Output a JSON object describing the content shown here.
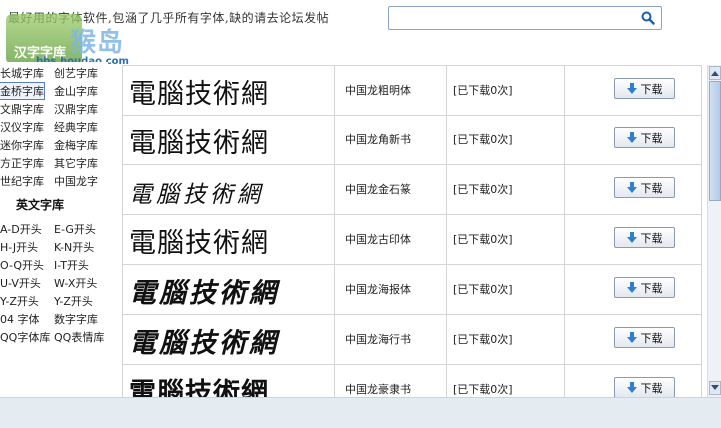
{
  "header": {
    "tagline": "最好用的字体软件,包涵了几乎所有字体,缺的请去论坛发帖",
    "search": {
      "value": "",
      "placeholder": ""
    }
  },
  "watermark": {
    "badge_text": "汉字字库",
    "big_text": "猴岛",
    "url": "bbs.houdao.com"
  },
  "sidebar": {
    "chinese_rows": [
      [
        "长城字库",
        "创艺字库"
      ],
      [
        "金桥字库",
        "金山字库"
      ],
      [
        "文鼎字库",
        "汉鼎字库"
      ],
      [
        "汉仪字库",
        "经典字库"
      ],
      [
        "迷你字库",
        "金梅字库"
      ],
      [
        "方正字库",
        "其它字库"
      ],
      [
        "世纪字库",
        "中国龙字"
      ]
    ],
    "english_title": "英文字库",
    "english_rows": [
      [
        "A-D开头",
        "E-G开头"
      ],
      [
        "H-J开头",
        "K-N开头"
      ],
      [
        "O-Q开头",
        "I-T开头"
      ],
      [
        "U-V开头",
        "W-X开头"
      ],
      [
        "Y-Z开头",
        "Y-Z开头"
      ],
      [
        "04 字体",
        "数字字库"
      ],
      [
        "QQ字体库",
        "QQ表情库"
      ]
    ]
  },
  "fonts": [
    {
      "sample": "電腦技術網",
      "name": "中国龙粗明体",
      "count": "[已下载0次]",
      "button": "下载"
    },
    {
      "sample": "電腦技術網",
      "name": "中国龙角新书",
      "count": "[已下载0次]",
      "button": "下载"
    },
    {
      "sample": "電腦技術網",
      "name": "中国龙金石篆",
      "count": "[已下载0次]",
      "button": "下载"
    },
    {
      "sample": "電腦技術網",
      "name": "中国龙古印体",
      "count": "[已下载0次]",
      "button": "下载"
    },
    {
      "sample": "電腦技術網",
      "name": "中国龙海报体",
      "count": "[已下载0次]",
      "button": "下载"
    },
    {
      "sample": "電腦技術網",
      "name": "中国龙海行书",
      "count": "[已下载0次]",
      "button": "下载"
    },
    {
      "sample": "電腦技術網",
      "name": "中国龙豪隶书",
      "count": "[已下载0次]",
      "button": "下载"
    }
  ],
  "colors": {
    "accent": "#2a6fb0",
    "footer": "#e4ecf1"
  }
}
